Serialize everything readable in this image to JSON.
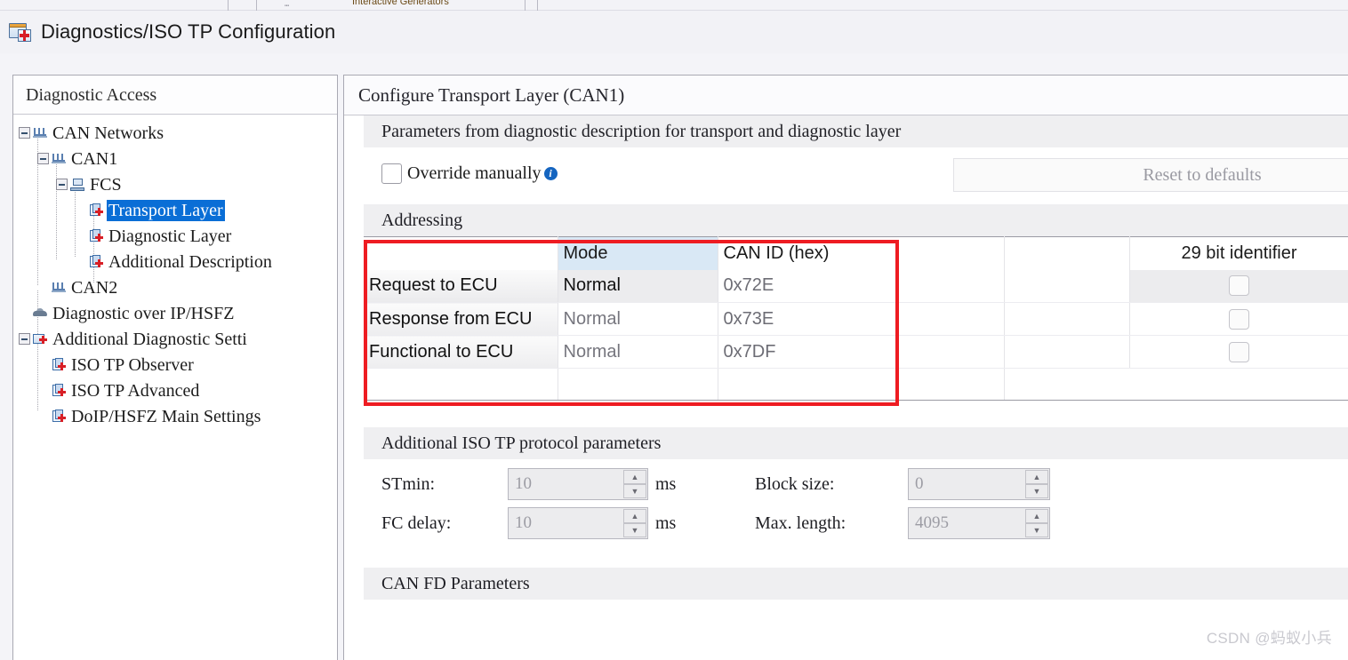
{
  "top_strip": {
    "fragment": "Interactive Generators"
  },
  "window": {
    "title": "Diagnostics/ISO TP Configuration",
    "icon": "diagnostics-config-icon"
  },
  "tree": {
    "header": "Diagnostic Access",
    "items": [
      {
        "label": "CAN Networks",
        "depth": 0,
        "icon": "network-icon",
        "expander": "minus",
        "selected": false
      },
      {
        "label": "CAN1",
        "depth": 1,
        "icon": "network-icon",
        "expander": "minus",
        "selected": false
      },
      {
        "label": "FCS",
        "depth": 2,
        "icon": "ecu-icon",
        "expander": "minus",
        "selected": false
      },
      {
        "label": "Transport Layer",
        "depth": 3,
        "icon": "document-icon",
        "expander": "none",
        "selected": true
      },
      {
        "label": "Diagnostic Layer",
        "depth": 3,
        "icon": "document-icon",
        "expander": "none",
        "selected": false
      },
      {
        "label": "Additional Description",
        "depth": 3,
        "icon": "document-icon",
        "expander": "none",
        "selected": false
      },
      {
        "label": "CAN2",
        "depth": 1,
        "icon": "network-icon",
        "expander": "none",
        "selected": false
      },
      {
        "label": "Diagnostic over IP/HSFZ",
        "depth": 0,
        "icon": "vehicle-icon",
        "expander": "none",
        "selected": false
      },
      {
        "label": "Additional Diagnostic Setti",
        "depth": 0,
        "icon": "folder-icon",
        "expander": "minus",
        "selected": false
      },
      {
        "label": "ISO TP Observer",
        "depth": 1,
        "icon": "document-icon",
        "expander": "none",
        "selected": false
      },
      {
        "label": "ISO TP Advanced",
        "depth": 1,
        "icon": "document-icon",
        "expander": "none",
        "selected": false
      },
      {
        "label": "DoIP/HSFZ Main Settings",
        "depth": 1,
        "icon": "document-icon",
        "expander": "none",
        "selected": false
      }
    ]
  },
  "pane": {
    "title": "Configure Transport Layer (CAN1)",
    "params_section": "Parameters from diagnostic description for transport and diagnostic layer",
    "override_label": "Override manually",
    "reset_button": "Reset to defaults",
    "addressing_section": "Addressing",
    "iso_section": "Additional ISO TP protocol parameters",
    "canfd_section": "CAN FD Parameters"
  },
  "addressing_table": {
    "columns": [
      "",
      "Mode",
      "CAN ID (hex)",
      "",
      "29 bit identifier"
    ],
    "rows": [
      {
        "name": "Request to ECU",
        "mode": "Normal",
        "can_id": "0x72E",
        "gap": "",
        "bit29": false
      },
      {
        "name": "Response from ECU",
        "mode": "Normal",
        "can_id": "0x73E",
        "gap": "",
        "bit29": false
      },
      {
        "name": "Functional to ECU",
        "mode": "Normal",
        "can_id": "0x7DF",
        "gap": "",
        "bit29": false
      }
    ]
  },
  "iso_params": {
    "stmin_label": "STmin:",
    "stmin_value": "10",
    "stmin_unit": "ms",
    "fcdelay_label": "FC delay:",
    "fcdelay_value": "10",
    "fcdelay_unit": "ms",
    "blocksize_label": "Block size:",
    "blocksize_value": "0",
    "maxlength_label": "Max. length:",
    "maxlength_value": "4095"
  },
  "watermark": "CSDN @蚂蚁小兵",
  "colors": {
    "selection_blue": "#0a6ed6",
    "highlight_red": "#ee1c22",
    "mode_header_blue": "#d9e8f5",
    "section_bar": "#efeff1",
    "info_icon_blue": "#1565c0"
  }
}
